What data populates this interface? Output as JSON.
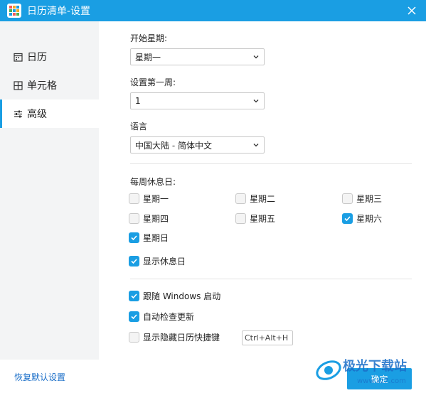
{
  "window": {
    "title": "日历清单-设置"
  },
  "sidebar": {
    "items": [
      {
        "label": "日历",
        "icon": "calendar-icon"
      },
      {
        "label": "单元格",
        "icon": "grid-icon"
      },
      {
        "label": "高级",
        "icon": "sliders-icon"
      }
    ],
    "active_index": 2
  },
  "settings": {
    "week_start": {
      "label": "开始星期:",
      "value": "星期一"
    },
    "first_week": {
      "label": "设置第一周:",
      "value": "1"
    },
    "language": {
      "label": "语言",
      "value": "中国大陆 - 简体中文"
    },
    "rest_days": {
      "label": "每周休息日:",
      "days": [
        {
          "label": "星期一",
          "checked": false
        },
        {
          "label": "星期二",
          "checked": false
        },
        {
          "label": "星期三",
          "checked": false
        },
        {
          "label": "星期四",
          "checked": false
        },
        {
          "label": "星期五",
          "checked": false
        },
        {
          "label": "星期六",
          "checked": true
        },
        {
          "label": "星期日",
          "checked": true
        }
      ]
    },
    "show_rest_days": {
      "label": "显示休息日",
      "checked": true
    },
    "startup": {
      "label": "跟随 Windows 启动",
      "checked": true
    },
    "auto_update": {
      "label": "自动检查更新",
      "checked": true
    },
    "hotkey": {
      "label": "显示隐藏日历快捷键",
      "checked": false,
      "value": "Ctrl+Alt+H"
    }
  },
  "footer": {
    "reset_label": "恢复默认设置",
    "ok_label": "确定"
  },
  "watermark": {
    "text": "极光下载站",
    "url_text": "www.xz7.com"
  },
  "colors": {
    "accent": "#1a9ee3",
    "sidebar_bg": "#f3f4f5",
    "link": "#1a6ec8"
  }
}
